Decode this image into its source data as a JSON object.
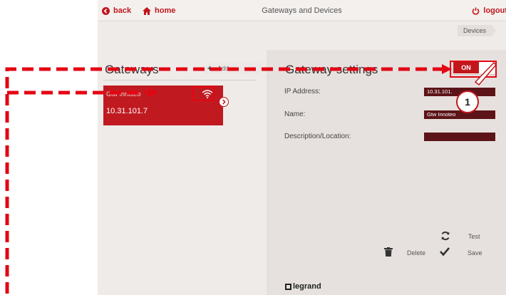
{
  "topbar": {
    "back_label": "back",
    "home_label": "home",
    "title": "Gateways and Devices",
    "logout_label": "logout"
  },
  "breadcrumb": {
    "devices": "Devices"
  },
  "gateways": {
    "heading": "Gateways",
    "add_label": "Add",
    "items": [
      {
        "name": "Gtw Innoteo",
        "ip": "10.31.101.7"
      }
    ]
  },
  "settings": {
    "heading": "Gateway settings",
    "toggle_label": "ON",
    "ip_label": "IP Address:",
    "ip_value": "10.31.101.",
    "name_label": "Name:",
    "name_value": "Gtw Innoteo",
    "desc_label": "Description/Location:",
    "desc_value": "",
    "test_label": "Test",
    "delete_label": "Delete",
    "save_label": "Save"
  },
  "logo_text": "legrand",
  "callout_number": "1",
  "colors": {
    "accent": "#c0171c",
    "field_bg": "#5c1418",
    "panel_bg": "#e6e1de"
  }
}
